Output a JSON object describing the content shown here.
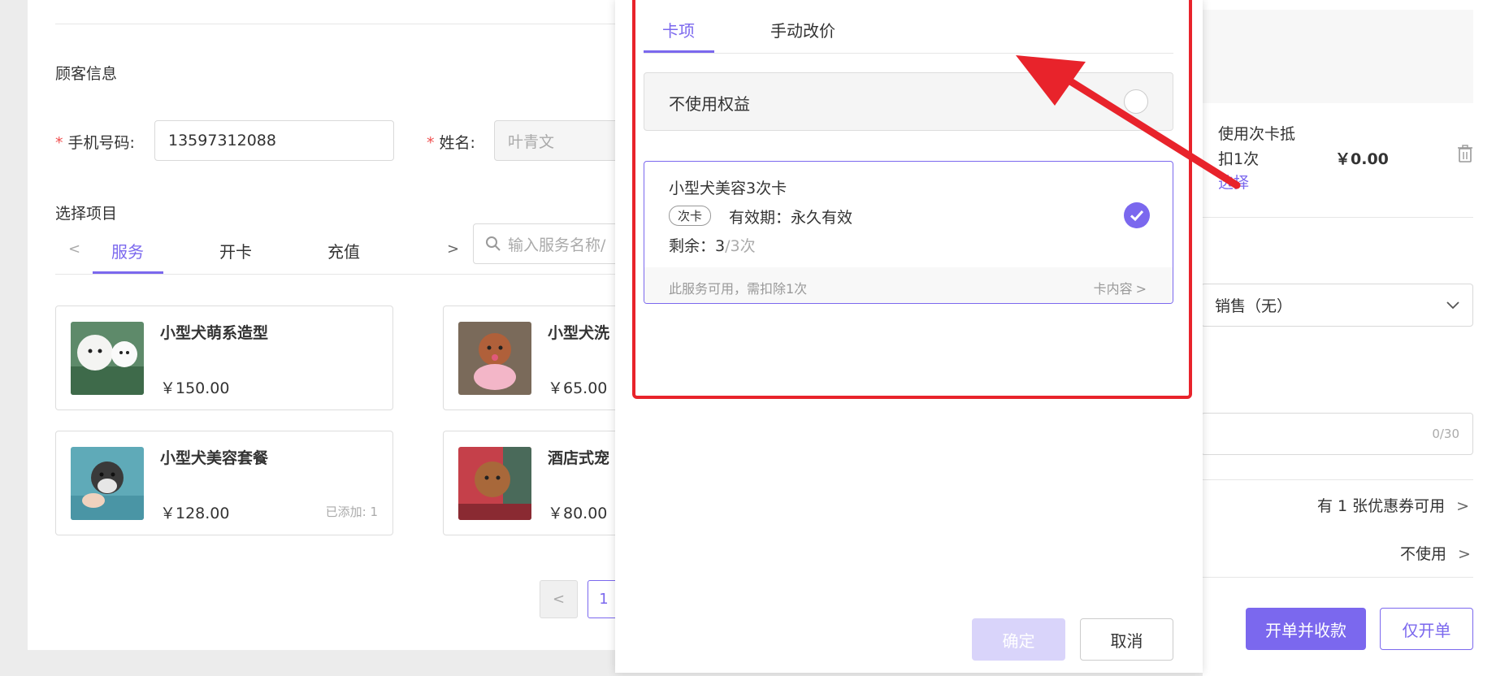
{
  "customer": {
    "section_title": "顾客信息",
    "phone_label": "手机号码:",
    "phone_value": "13597312088",
    "name_label": "姓名:",
    "name_placeholder": "叶青文",
    "required_mark": "*"
  },
  "items": {
    "section_title": "选择项目",
    "tabs": [
      {
        "label": "服务"
      },
      {
        "label": "开卡"
      },
      {
        "label": "充值"
      }
    ],
    "search_placeholder": "输入服务名称/",
    "services": [
      {
        "name": "小型犬萌系造型",
        "price": "￥150.00",
        "added": ""
      },
      {
        "name": "小型犬洗",
        "price": "￥65.00",
        "added": ""
      },
      {
        "name": "小型犬美容套餐",
        "price": "￥128.00",
        "added": "已添加: 1"
      },
      {
        "name": "酒店式宠",
        "price": "￥80.00",
        "added": ""
      }
    ],
    "pagination": {
      "prev": "<",
      "current": "1"
    }
  },
  "order": {
    "deduct_line1": "使用次卡抵",
    "deduct_line2": "扣1次",
    "deduct_amount": "￥0.00",
    "select_link": "选择",
    "sales_value": "销售（无）",
    "note_counter": "0/30",
    "coupon_text": "有 1 张优惠券可用",
    "discount_text": "不使用",
    "submit_pay_label": "开单并收款",
    "submit_only_label": "仅开单"
  },
  "modal": {
    "tabs": [
      {
        "label": "卡项"
      },
      {
        "label": "手动改价"
      }
    ],
    "no_benefit_label": "不使用权益",
    "card": {
      "name": "小型犬美容3次卡",
      "tag": "次卡",
      "validity": "有效期：永久有效",
      "remaining_label": "剩余：",
      "remaining_used": "3",
      "remaining_total": "/3次",
      "footer_note": "此服务可用，需扣除1次",
      "detail_link": "卡内容"
    },
    "confirm_label": "确定",
    "cancel_label": "取消"
  },
  "colors": {
    "accent": "#7b68ee",
    "annotation_red": "#e8232b",
    "required": "#f05050"
  }
}
